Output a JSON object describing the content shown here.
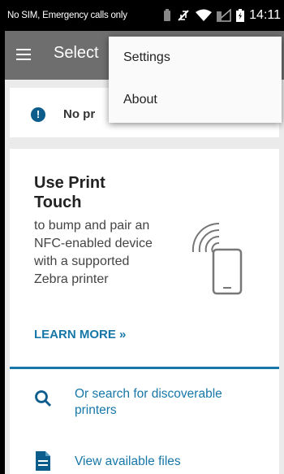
{
  "statusbar": {
    "carrier_text": "No SIM, Emergency calls only",
    "time": "14:11"
  },
  "appbar": {
    "title": "Select"
  },
  "alert_card": {
    "text": "No pr"
  },
  "print_touch": {
    "title": "Use Print Touch",
    "description": "to bump and pair an NFC-enabled device with a supported Zebra printer",
    "learn_more": "LEARN MORE »"
  },
  "actions": {
    "search_label": "Or search for discoverable printers",
    "files_label": "View available files"
  },
  "overflow_menu": {
    "items": [
      "Settings",
      "About"
    ]
  },
  "colors": {
    "accent": "#1677a8",
    "appbar": "#6e6e6e",
    "alert_icon": "#0d5d8c"
  },
  "icons": {
    "menu": "hamburger-icon",
    "alert": "exclamation-circle-icon",
    "search": "search-icon",
    "file": "file-icon",
    "nfc": "nfc-phone-icon"
  }
}
